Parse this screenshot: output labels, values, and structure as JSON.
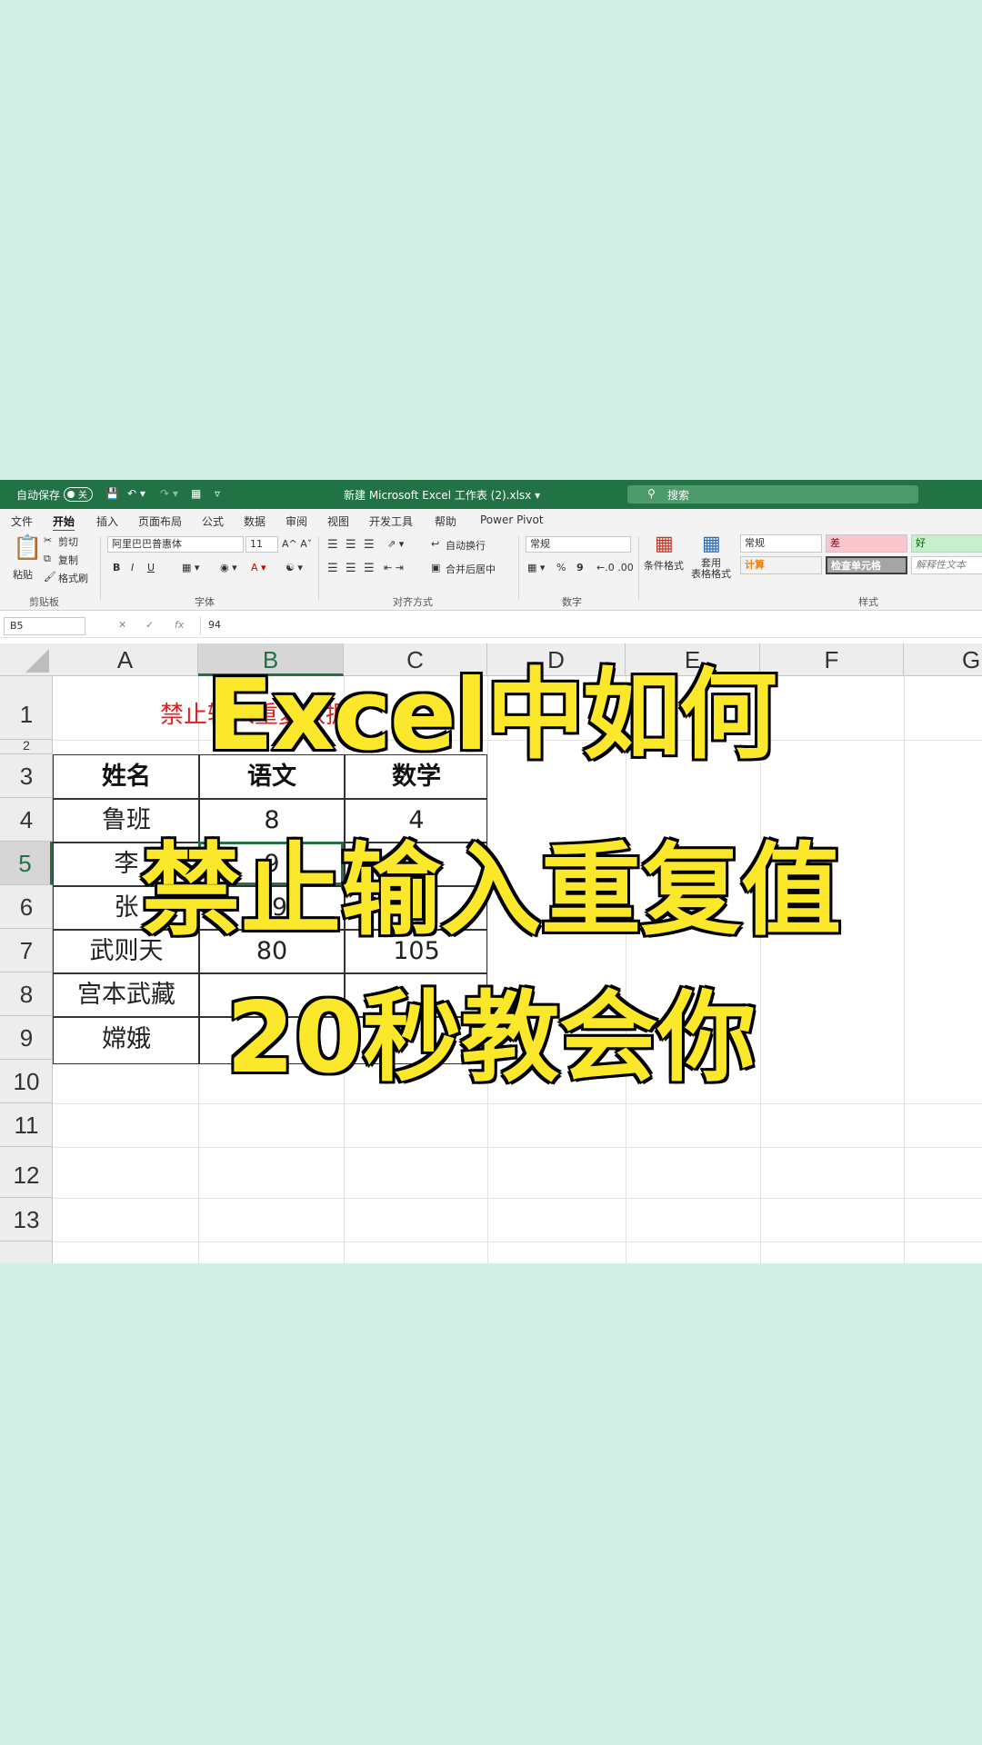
{
  "titlebar": {
    "autosave_label": "自动保存",
    "autosave_state": "关",
    "file_title": "新建 Microsoft Excel 工作表 (2).xlsx  ▾",
    "search_placeholder": "搜索"
  },
  "tabs": [
    "文件",
    "开始",
    "插入",
    "页面布局",
    "公式",
    "数据",
    "审阅",
    "视图",
    "开发工具",
    "帮助",
    "Power Pivot"
  ],
  "ribbon": {
    "clipboard": {
      "paste": "粘贴",
      "cut": "剪切",
      "copy": "复制",
      "format_painter": "格式刷",
      "group": "剪贴板"
    },
    "font": {
      "name": "阿里巴巴普惠体",
      "size": "11",
      "bold": "B",
      "italic": "I",
      "underline": "U",
      "group": "字体"
    },
    "alignment": {
      "wrap": "自动换行",
      "merge": "合并后居中",
      "group": "对齐方式"
    },
    "number": {
      "format": "常规",
      "percent": "%",
      "comma": "9",
      "group": "数字"
    },
    "styles": {
      "conditional": "条件格式",
      "table_format": "套用\n表格格式",
      "normal": "常规",
      "bad": "差",
      "good": "好",
      "calc": "计算",
      "check": "检查单元格",
      "explain": "解释性文本",
      "group": "样式"
    }
  },
  "formula_bar": {
    "name_box": "B5",
    "cancel": "✕",
    "enter": "✓",
    "fx": "fx",
    "value": "94"
  },
  "columns": [
    "A",
    "B",
    "C",
    "D",
    "E",
    "F",
    "G"
  ],
  "rows": [
    "1",
    "2",
    "3",
    "4",
    "5",
    "6",
    "7",
    "8",
    "9",
    "10",
    "11",
    "12",
    "13"
  ],
  "sheet": {
    "title": "禁止输入重复数据",
    "headers": [
      "姓名",
      "语文",
      "数学"
    ],
    "cells": [
      [
        "鲁班",
        "8",
        "4"
      ],
      [
        "李",
        "9",
        ""
      ],
      [
        "张",
        "89",
        ""
      ],
      [
        "武则天",
        "80",
        "105"
      ],
      [
        "宫本武藏",
        "",
        ""
      ],
      [
        "嫦娥",
        "",
        ""
      ]
    ]
  },
  "overlay": {
    "line1": "Excel中如何",
    "line2": "禁止输入重复值",
    "line3": "20秒教会你"
  },
  "colors": {
    "excel_green": "#217346",
    "background": "#d4efe5",
    "caption_yellow": "#fbe82a",
    "title_red": "#e02020"
  }
}
